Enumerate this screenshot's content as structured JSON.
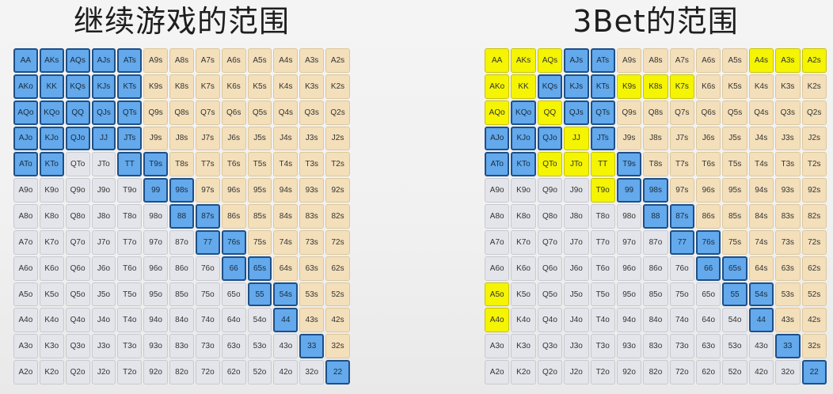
{
  "left": {
    "title": "继续游戏的范围",
    "rows": [
      [
        "AA",
        "AKs",
        "AQs",
        "AJs",
        "ATs",
        "A9s",
        "A8s",
        "A7s",
        "A6s",
        "A5s",
        "A4s",
        "A3s",
        "A2s"
      ],
      [
        "AKo",
        "KK",
        "KQs",
        "KJs",
        "KTs",
        "K9s",
        "K8s",
        "K7s",
        "K6s",
        "K5s",
        "K4s",
        "K3s",
        "K2s"
      ],
      [
        "AQo",
        "KQo",
        "QQ",
        "QJs",
        "QTs",
        "Q9s",
        "Q8s",
        "Q7s",
        "Q6s",
        "Q5s",
        "Q4s",
        "Q3s",
        "Q2s"
      ],
      [
        "AJo",
        "KJo",
        "QJo",
        "JJ",
        "JTs",
        "J9s",
        "J8s",
        "J7s",
        "J6s",
        "J5s",
        "J4s",
        "J3s",
        "J2s"
      ],
      [
        "ATo",
        "KTo",
        "QTo",
        "JTo",
        "TT",
        "T9s",
        "T8s",
        "T7s",
        "T6s",
        "T5s",
        "T4s",
        "T3s",
        "T2s"
      ],
      [
        "A9o",
        "K9o",
        "Q9o",
        "J9o",
        "T9o",
        "99",
        "98s",
        "97s",
        "96s",
        "95s",
        "94s",
        "93s",
        "92s"
      ],
      [
        "A8o",
        "K8o",
        "Q8o",
        "J8o",
        "T8o",
        "98o",
        "88",
        "87s",
        "86s",
        "85s",
        "84s",
        "83s",
        "82s"
      ],
      [
        "A7o",
        "K7o",
        "Q7o",
        "J7o",
        "T7o",
        "97o",
        "87o",
        "77",
        "76s",
        "75s",
        "74s",
        "73s",
        "72s"
      ],
      [
        "A6o",
        "K6o",
        "Q6o",
        "J6o",
        "T6o",
        "96o",
        "86o",
        "76o",
        "66",
        "65s",
        "64s",
        "63s",
        "62s"
      ],
      [
        "A5o",
        "K5o",
        "Q5o",
        "J5o",
        "T5o",
        "95o",
        "85o",
        "75o",
        "65o",
        "55",
        "54s",
        "53s",
        "52s"
      ],
      [
        "A4o",
        "K4o",
        "Q4o",
        "J4o",
        "T4o",
        "94o",
        "84o",
        "74o",
        "64o",
        "54o",
        "44",
        "43s",
        "42s"
      ],
      [
        "A3o",
        "K3o",
        "Q3o",
        "J3o",
        "T3o",
        "93o",
        "83o",
        "73o",
        "63o",
        "53o",
        "43o",
        "33",
        "32s"
      ],
      [
        "A2o",
        "K2o",
        "Q2o",
        "J2o",
        "T2o",
        "92o",
        "82o",
        "72o",
        "62o",
        "52o",
        "42o",
        "32o",
        "22"
      ]
    ],
    "highlights": [
      "AA",
      "AKs",
      "AQs",
      "AJs",
      "ATs",
      "AKo",
      "KK",
      "KQs",
      "KJs",
      "KTs",
      "AQo",
      "KQo",
      "QQ",
      "QJs",
      "QTs",
      "AJo",
      "KJo",
      "QJo",
      "JJ",
      "JTs",
      "ATo",
      "KTo",
      "TT",
      "T9s",
      "99",
      "98s",
      "88",
      "87s",
      "77",
      "76s",
      "66",
      "65s",
      "55",
      "54s",
      "44",
      "33",
      "22"
    ]
  },
  "right": {
    "title": "3Bet的范围",
    "rows": [
      [
        "AA",
        "AKs",
        "AQs",
        "AJs",
        "ATs",
        "A9s",
        "A8s",
        "A7s",
        "A6s",
        "A5s",
        "A4s",
        "A3s",
        "A2s"
      ],
      [
        "AKo",
        "KK",
        "KQs",
        "KJs",
        "KTs",
        "K9s",
        "K8s",
        "K7s",
        "K6s",
        "K5s",
        "K4s",
        "K3s",
        "K2s"
      ],
      [
        "AQo",
        "KQo",
        "QQ",
        "QJs",
        "QTs",
        "Q9s",
        "Q8s",
        "Q7s",
        "Q6s",
        "Q5s",
        "Q4s",
        "Q3s",
        "Q2s"
      ],
      [
        "AJo",
        "KJo",
        "QJo",
        "JJ",
        "JTs",
        "J9s",
        "J8s",
        "J7s",
        "J6s",
        "J5s",
        "J4s",
        "J3s",
        "J2s"
      ],
      [
        "ATo",
        "KTo",
        "QTo",
        "JTo",
        "TT",
        "T9s",
        "T8s",
        "T7s",
        "T6s",
        "T5s",
        "T4s",
        "T3s",
        "T2s"
      ],
      [
        "A9o",
        "K9o",
        "Q9o",
        "J9o",
        "T9o",
        "99",
        "98s",
        "97s",
        "96s",
        "95s",
        "94s",
        "93s",
        "92s"
      ],
      [
        "A8o",
        "K8o",
        "Q8o",
        "J8o",
        "T8o",
        "98o",
        "88",
        "87s",
        "86s",
        "85s",
        "84s",
        "83s",
        "82s"
      ],
      [
        "A7o",
        "K7o",
        "Q7o",
        "J7o",
        "T7o",
        "97o",
        "87o",
        "77",
        "76s",
        "75s",
        "74s",
        "73s",
        "72s"
      ],
      [
        "A6o",
        "K6o",
        "Q6o",
        "J6o",
        "T6o",
        "96o",
        "86o",
        "76o",
        "66",
        "65s",
        "64s",
        "63s",
        "62s"
      ],
      [
        "A5o",
        "K5o",
        "Q5o",
        "J5o",
        "T5o",
        "95o",
        "85o",
        "75o",
        "65o",
        "55",
        "54s",
        "53s",
        "52s"
      ],
      [
        "A4o",
        "K4o",
        "Q4o",
        "J4o",
        "T4o",
        "94o",
        "84o",
        "74o",
        "64o",
        "54o",
        "44",
        "43s",
        "42s"
      ],
      [
        "A3o",
        "K3o",
        "Q3o",
        "J3o",
        "T3o",
        "93o",
        "83o",
        "73o",
        "63o",
        "53o",
        "43o",
        "33",
        "32s"
      ],
      [
        "A2o",
        "K2o",
        "Q2o",
        "J2o",
        "T2o",
        "92o",
        "82o",
        "72o",
        "62o",
        "52o",
        "42o",
        "32o",
        "22"
      ]
    ],
    "blue": [
      "AJs",
      "ATs",
      "KQs",
      "KJs",
      "KTs",
      "KQo",
      "QJs",
      "QTs",
      "AJo",
      "KJo",
      "QJo",
      "JTs",
      "ATo",
      "KTo",
      "T9s",
      "99",
      "98s",
      "88",
      "87s",
      "77",
      "76s",
      "66",
      "65s",
      "55",
      "54s",
      "44",
      "33",
      "22"
    ],
    "yellow": [
      "AA",
      "AKs",
      "AQs",
      "A4s",
      "A3s",
      "A2s",
      "AKo",
      "KK",
      "K9s",
      "K8s",
      "K7s",
      "AQo",
      "QQ",
      "JJ",
      "QTo",
      "JTo",
      "TT",
      "T9o",
      "A5o",
      "A4o"
    ]
  },
  "colors": {
    "highlight_blue": "#63a9ec",
    "highlight_yellow": "#f4f403",
    "suited": "#f3dfba",
    "offsuit": "#e4e5ea"
  }
}
